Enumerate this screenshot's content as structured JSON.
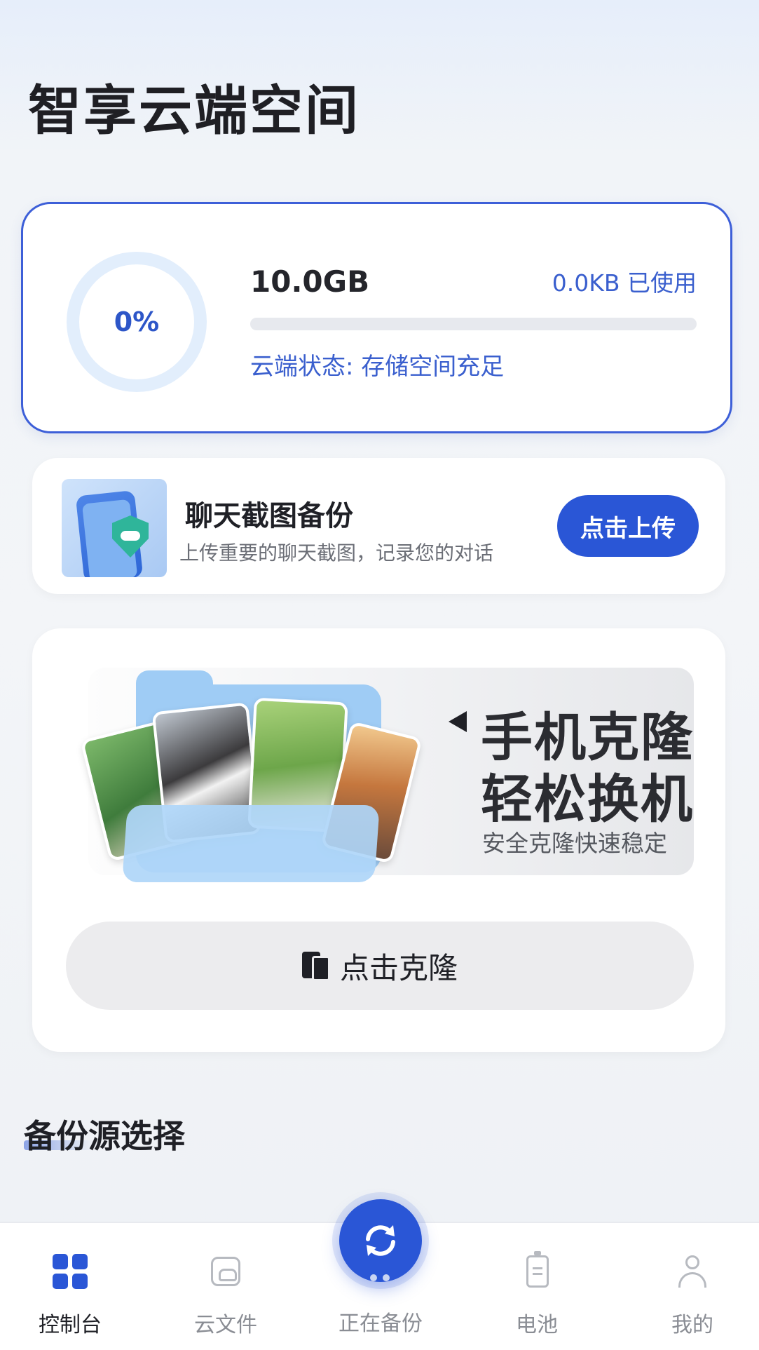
{
  "header": {
    "title": "智享云端空间"
  },
  "storage": {
    "percent_label": "0%",
    "percent_value": 0,
    "capacity": "10.0GB",
    "used": "0.0KB 已使用",
    "status": "云端状态: 存储空间充足",
    "accent_color": "#3a5fce"
  },
  "chat_backup": {
    "title": "聊天截图备份",
    "subtitle": "上传重要的聊天截图，记录您的对话",
    "button": "点击上传"
  },
  "clone": {
    "headline1": "手机克隆",
    "headline2": "轻松换机",
    "subtitle": "安全克隆快速稳定",
    "button": "点击克隆"
  },
  "section": {
    "title": "备份源选择"
  },
  "bottom_nav": {
    "items": [
      {
        "label": "控制台",
        "icon": "dashboard-grid-icon",
        "active": true
      },
      {
        "label": "云文件",
        "icon": "cloud-folder-icon",
        "active": false
      },
      {
        "label": "正在备份",
        "icon": "sync-icon",
        "active": false
      },
      {
        "label": "电池",
        "icon": "battery-icon",
        "active": false
      },
      {
        "label": "我的",
        "icon": "user-icon",
        "active": false
      }
    ],
    "active_color": "#2a56d6"
  }
}
